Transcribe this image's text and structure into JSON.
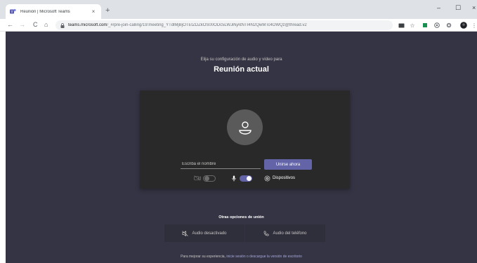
{
  "browser": {
    "tab": {
      "title": "Reunión | Microsoft Teams",
      "close_glyph": "×"
    },
    "new_tab_glyph": "+",
    "window_controls": {
      "minimize": "–",
      "restore": "☐",
      "close": "×"
    },
    "nav": {
      "back": "←",
      "forward": "→",
      "reload": "C",
      "home": "⌂"
    },
    "url": {
      "host": "teams.microsoft.com",
      "path": "/_#/pre-join-calling/19:meeting_YTdlMjBjOTEtZDZkOS00ODc5LWJiNjAtNTI4N2QwMTc4OWQz@thread.v2"
    },
    "toolbar_icons": [
      "cast-icon",
      "star-icon",
      "extension-green-icon",
      "extension-gray-icon",
      "extension-icon",
      "profile-avatar",
      "menu-icon"
    ],
    "colors": {
      "tabstrip": "#dee1e6",
      "omnibox": "#f1f3f4"
    }
  },
  "page": {
    "subtitle": "Elija su configuración de audio y vídeo para",
    "title": "Reunión actual",
    "name_placeholder": "Escriba el nombre",
    "join_button": "Unirse ahora",
    "camera_toggle": {
      "state": "off"
    },
    "mic_toggle": {
      "state": "on"
    },
    "devices_label": "Dispositivos",
    "other_options_title": "Otras opciones de unión",
    "options": [
      {
        "label": "Audio desactivado",
        "icon": "speaker-off-icon"
      },
      {
        "label": "Audio del teléfono",
        "icon": "phone-icon"
      }
    ],
    "footer": {
      "prefix": "Para mejorar su experiencia,",
      "link": "inicie sesión o descargue la versión de escritorio"
    },
    "colors": {
      "background": "#353444",
      "preview": "#292929",
      "accent": "#6264a7"
    }
  }
}
